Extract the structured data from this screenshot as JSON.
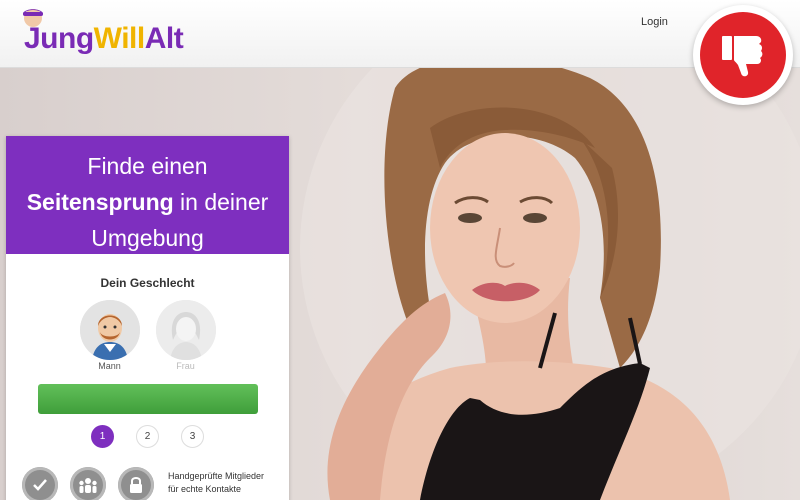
{
  "header": {
    "logo": {
      "part1": "Jung",
      "part2": "Will",
      "part3": "Alt"
    },
    "login_label": "Login"
  },
  "badge": {
    "icon": "thumbs-down-icon",
    "color": "#e0242a"
  },
  "card": {
    "headline": {
      "line1": "Finde einen",
      "line2_bold": "Seitensprung",
      "line2_rest": " in deiner",
      "line3": "Umgebung"
    },
    "gender_title": "Dein Geschlecht",
    "genders": [
      {
        "label": "Mann",
        "icon": "male-avatar-icon"
      },
      {
        "label": "Frau",
        "icon": "female-avatar-icon"
      }
    ],
    "steps": [
      "1",
      "2",
      "3"
    ],
    "active_step": "1",
    "feature_text_line1": "Handgeprüfte Mitglieder",
    "feature_text_line2": "für echte Kontakte"
  },
  "colors": {
    "brand_purple": "#7e2fbf",
    "accent_yellow": "#f0b400",
    "button_green": "#4cae44"
  }
}
